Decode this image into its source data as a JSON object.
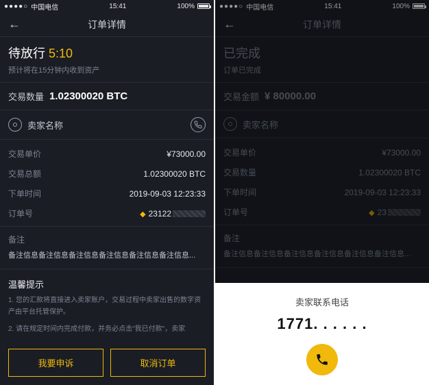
{
  "left": {
    "status_bar": {
      "carrier": "中国电信",
      "signal": "●●●●○",
      "time": "15:41",
      "battery": "100%"
    },
    "nav": {
      "title": "订单详情"
    },
    "order_status": {
      "label": "待放行",
      "countdown": "5:10",
      "sub": "预计将在15分钟内收到资产"
    },
    "trade_amount": {
      "label": "交易数量",
      "value": "1.02300020 BTC"
    },
    "seller": {
      "label": "卖家名称"
    },
    "details": [
      {
        "k": "交易单价",
        "v": "¥73000.00"
      },
      {
        "k": "交易总额",
        "v": "1.02300020 BTC"
      },
      {
        "k": "下单时间",
        "v": "2019-09-03 12:23:33"
      },
      {
        "k": "订单号",
        "v": "23122",
        "shield": true,
        "pixellated": true
      }
    ],
    "remark": {
      "label": "备注",
      "text": "备注信息备注信息备注信息备注信息备注信息备注信息..."
    },
    "tips": {
      "label": "温馨提示",
      "items": [
        "1. 您的汇款将直接进入卖家账户，交易过程中卖家出售的数字资产由平台托管保护。",
        "2. 请在规定时间内完成付款，并务必点击\"我已付款\"，卖家"
      ]
    },
    "buttons": {
      "appeal": "我要申诉",
      "cancel": "取消订单"
    }
  },
  "right": {
    "status_bar": {
      "carrier": "中国电信",
      "signal": "●●●●○",
      "time": "15:41",
      "battery": "100%"
    },
    "nav": {
      "title": "订单详情"
    },
    "order_status": {
      "label": "已完成",
      "sub": "订单已完成"
    },
    "trade_amount": {
      "label": "交易金额",
      "value": "¥ 80000.00"
    },
    "seller": {
      "label": "卖家名称"
    },
    "details": [
      {
        "k": "交易单价",
        "v": "¥73000.00"
      },
      {
        "k": "交易数量",
        "v": "1.02300020 BTC"
      },
      {
        "k": "下单时间",
        "v": "2019-09-03 12:23:33"
      },
      {
        "k": "订单号",
        "v": "23",
        "shield": true,
        "pixellated": true
      }
    ],
    "remark": {
      "label": "备注",
      "text": "备注信息备注信息备注信息备注信息备注信息备注信息..."
    },
    "sheet": {
      "title": "卖家联系电话",
      "number": "1771. . . . . ."
    }
  }
}
